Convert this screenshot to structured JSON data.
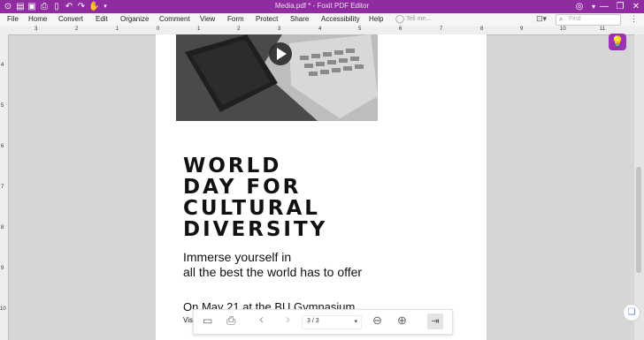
{
  "app": {
    "window_title": "Media.pdf * - Foxit PDF Editor",
    "quick_access": [
      "open-icon",
      "save-icon",
      "save-as-icon",
      "print-icon",
      "new-icon",
      "undo-icon",
      "redo-icon",
      "hand-tool-icon",
      "customize-icon"
    ]
  },
  "menu": {
    "items": [
      "File",
      "Home",
      "Convert",
      "Edit",
      "Organize",
      "Comment",
      "View",
      "Form",
      "Protect",
      "Share",
      "Accessibility",
      "Help"
    ],
    "tell_me_placeholder": "Tell me...",
    "find_placeholder": "Find"
  },
  "ruler": {
    "h_labels": [
      "3",
      "2",
      "1",
      "0",
      "1",
      "2",
      "3",
      "4",
      "5",
      "6",
      "7",
      "8",
      "9",
      "10",
      "11"
    ],
    "v_labels": [
      "4",
      "5",
      "6",
      "7",
      "8",
      "9",
      "10"
    ]
  },
  "document": {
    "heading_lines": [
      "WORLD",
      "DAY FOR",
      "CULTURAL",
      "DIVERSITY"
    ],
    "sub_lines": [
      "Immerse yourself in",
      "all the best the world has to offer"
    ],
    "event_line": "On May 21 at the BU Gymnasium",
    "visit_prefix": "Vis"
  },
  "toolbar": {
    "page_indicator": "3 / 3"
  },
  "colors": {
    "accent": "#8f2c9f",
    "lightbulb_bg": "#9b31b3"
  }
}
